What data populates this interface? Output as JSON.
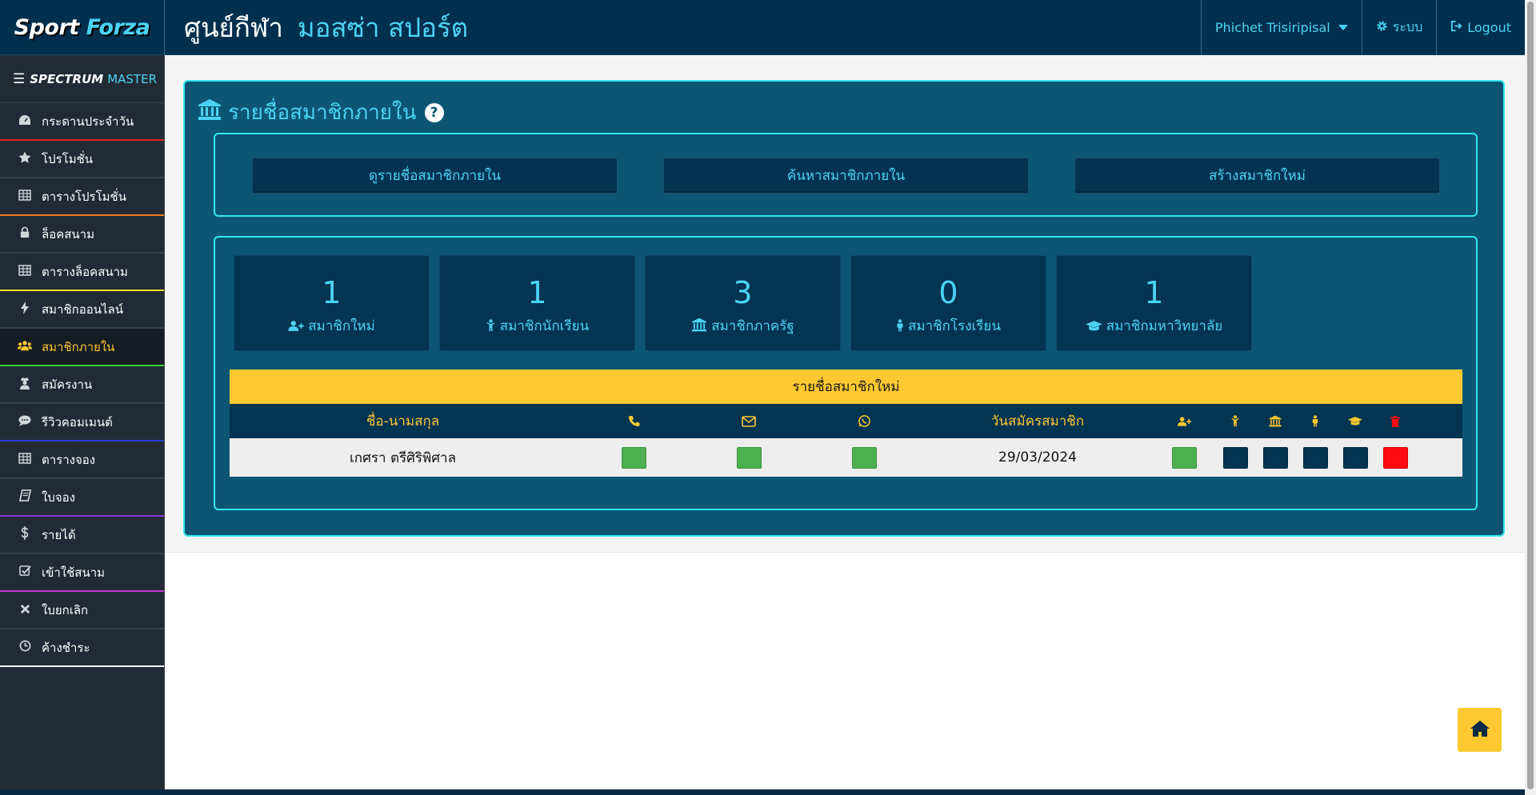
{
  "brand": {
    "part1": "Sport",
    "part2": "Forza"
  },
  "header": {
    "title_prefix": "ศูนย์กีฬา",
    "title_name": "มอสซ่า สปอร์ต",
    "user_name": "Phichet Trisiripisal",
    "system_label": "ระบบ",
    "logout_label": "Logout"
  },
  "sidebar": {
    "header_part1": "SPECTRUM",
    "header_part2": "MASTER",
    "items": [
      {
        "label": "กระดานประจำวัน",
        "icon": "dashboard-icon",
        "divider": "#e02424"
      },
      {
        "label": "โปรโมชั่น",
        "icon": "star-icon",
        "divider": "#39414a"
      },
      {
        "label": "ตารางโปรโมชั่น",
        "icon": "table-icon",
        "divider": "#f07a1f"
      },
      {
        "label": "ล็อคสนาม",
        "icon": "lock-icon",
        "divider": "#39414a"
      },
      {
        "label": "ตารางล็อคสนาม",
        "icon": "table-icon",
        "divider": "#e8e22c"
      },
      {
        "label": "สมาชิกออนไลน์",
        "icon": "bolt-icon",
        "divider": "#39414a"
      },
      {
        "label": "สมาชิกภายใน",
        "icon": "users-icon",
        "divider": "#3ed130"
      },
      {
        "label": "สมัครงาน",
        "icon": "user-secret-icon",
        "divider": "#39414a"
      },
      {
        "label": "รีวิวคอมเมนต์",
        "icon": "comment-icon",
        "divider": "#2a3fd6"
      },
      {
        "label": "ตารางจอง",
        "icon": "table-icon",
        "divider": "#39414a"
      },
      {
        "label": "ใบจอง",
        "icon": "book-icon",
        "divider": "#8a35d6"
      },
      {
        "label": "รายได้",
        "icon": "dollar-icon",
        "divider": "#39414a"
      },
      {
        "label": "เข้าใช้สนาม",
        "icon": "check-square-icon",
        "divider": "#c43ad8"
      },
      {
        "label": "ใบยกเลิก",
        "icon": "times-icon",
        "divider": "#39414a"
      },
      {
        "label": "ค้างชำระ",
        "icon": "clock-icon",
        "divider": "#ffffff"
      }
    ],
    "active_index": 6
  },
  "panel": {
    "title": "รายชื่อสมาชิกภายใน",
    "help": "?",
    "buttons": [
      "ดูรายชื่อสมาชิกภายใน",
      "ค้นหาสมาชิกภายใน",
      "สร้างสมาชิกใหม่"
    ],
    "stats": [
      {
        "value": "1",
        "label": "สมาชิกใหม่",
        "icon": "user-plus-icon"
      },
      {
        "value": "1",
        "label": "สมาชิกนักเรียน",
        "icon": "child-icon"
      },
      {
        "value": "3",
        "label": "สมาชิกภาครัฐ",
        "icon": "bank-icon"
      },
      {
        "value": "0",
        "label": "สมาชิกโรงเรียน",
        "icon": "male-icon"
      },
      {
        "value": "1",
        "label": "สมาชิกมหาวิทยาลัย",
        "icon": "graduation-cap-icon"
      }
    ],
    "table": {
      "caption": "รายชื่อสมาชิกใหม่",
      "col_name": "ชื่อ-นามสกุล",
      "col_date": "วันสมัครสมาชิก",
      "rows": [
        {
          "name": "เกศรา ตรีศิริพิศาล",
          "date": "29/03/2024"
        }
      ]
    }
  },
  "colors": {
    "accent": "#4cd3f3",
    "highlight": "#fdc830",
    "panel": "#0c5674",
    "ok": "#4caf50",
    "danger": "#ff0a12"
  }
}
